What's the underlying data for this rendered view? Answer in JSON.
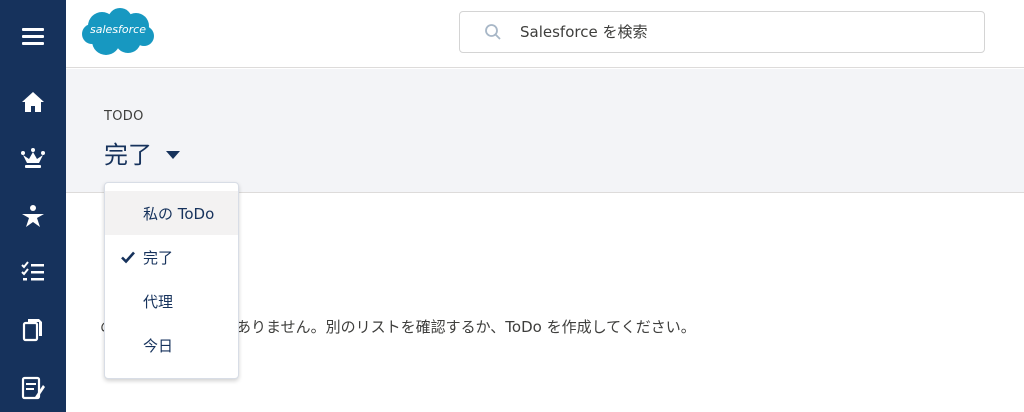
{
  "header": {
    "logo_text": "salesforce",
    "search_placeholder": "Salesforce を検索"
  },
  "nav": {
    "items": [
      {
        "icon": "hamburger-menu-icon"
      },
      {
        "icon": "home-icon"
      },
      {
        "icon": "crown-icon"
      },
      {
        "icon": "person-star-icon"
      },
      {
        "icon": "task-list-icon"
      },
      {
        "icon": "documents-icon"
      },
      {
        "icon": "notes-icon"
      }
    ]
  },
  "page": {
    "object_label": "TODO",
    "list_title": "完了",
    "empty_message": "のリストに ToDo はありません。別のリストを確認するか、ToDo を作成してください。"
  },
  "dropdown": {
    "items": [
      {
        "label": "私の ToDo",
        "selected": false,
        "hovered": true
      },
      {
        "label": "完了",
        "selected": true,
        "hovered": false
      },
      {
        "label": "代理",
        "selected": false,
        "hovered": false
      },
      {
        "label": "今日",
        "selected": false,
        "hovered": false
      }
    ]
  },
  "colors": {
    "nav_bg": "#16325c",
    "logo_blue": "#1798c1",
    "text_dark": "#16325c",
    "band_bg": "#f3f4f7"
  }
}
